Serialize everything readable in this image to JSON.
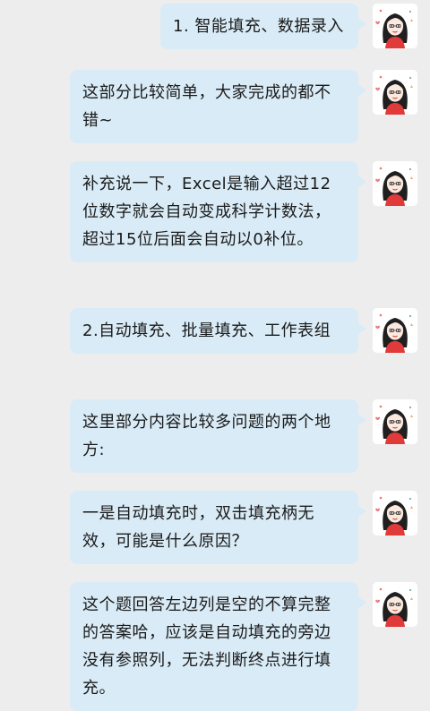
{
  "messages": [
    {
      "text": "1. 智能填充、数据录入"
    },
    {
      "text": "这部分比较简单，大家完成的都不错~"
    },
    {
      "text": "补充说一下，Excel是输入超过12位数字就会自动变成科学计数法，超过15位后面会自动以0补位。"
    },
    {
      "text": "2.自动填充、批量填充、工作表组"
    },
    {
      "text": "这里部分内容比较多问题的两个地方:"
    },
    {
      "text": "一是自动填充时，双击填充柄无效，可能是什么原因？"
    },
    {
      "text": "这个题回答左边列是空的不算完整的答案哈，应该是自动填充的旁边没有参照列，无法判断终点进行填充。"
    }
  ],
  "colors": {
    "background": "#ededed",
    "bubble": "#d9ebf6",
    "avatar_bg": "#ffffff"
  },
  "icons": {
    "avatar": "user-avatar-cartoon-girl-icon"
  }
}
